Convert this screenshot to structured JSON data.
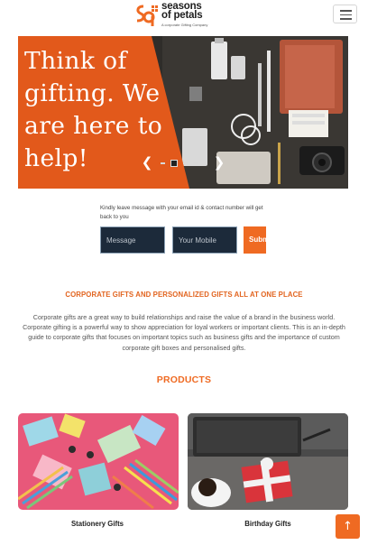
{
  "header": {
    "brand_line1": "seasons",
    "brand_line2": "of petals",
    "tagline": "A corporate Gifting Company",
    "menu_icon": "hamburger-icon"
  },
  "hero": {
    "headline": "Think of gifting. We are here to help!",
    "prev_icon": "chevron-left-icon",
    "next_icon": "chevron-right-icon",
    "slide_count": 5,
    "active_slide": 3,
    "accent_color": "#e2591b"
  },
  "message_form": {
    "hint": "Kindly leave message with your email id & contact number will get back to you",
    "message_placeholder": "Message",
    "mobile_placeholder": "Your Mobile",
    "submit_label": "Submit"
  },
  "corporate": {
    "heading": "CORPORATE GIFTS AND PERSONALIZED GIFTS ALL AT ONE PLACE",
    "body": "Corporate gifts are a great way to build relationships and raise the value of a brand in the business world. Corporate gifting is a powerful way to show appreciation for loyal workers or important clients. This is an in-depth guide to corporate gifts that focuses on important topics such as business gifts and the importance of custom corporate gift boxes and personalised gifts."
  },
  "products": {
    "heading": "PRODUCTS",
    "items": [
      {
        "label": "Stationery Gifts"
      },
      {
        "label": "Birthday Gifts"
      }
    ]
  },
  "back_to_top_icon": "arrow-up-icon",
  "colors": {
    "brand_orange": "#ef6a22",
    "input_navy": "#1c2a3a"
  }
}
